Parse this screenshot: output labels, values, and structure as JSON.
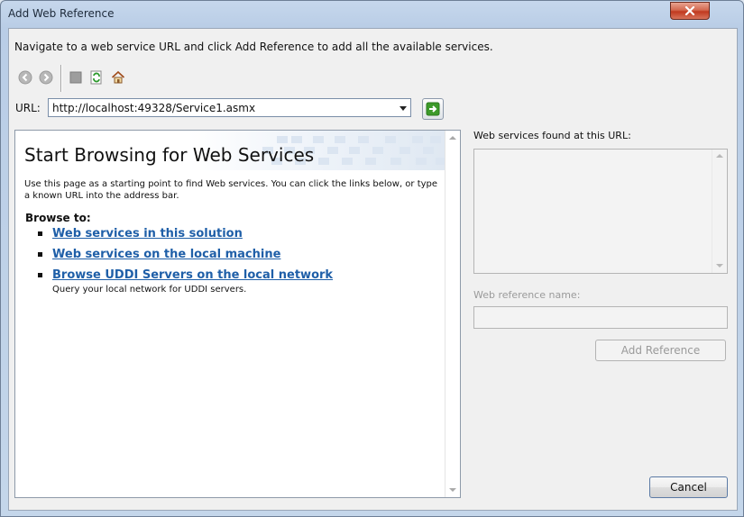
{
  "window": {
    "title": "Add Web Reference"
  },
  "instructions": "Navigate to a web service URL and click Add Reference to add all the available services.",
  "toolbar": {
    "icons": [
      "back-icon",
      "forward-icon",
      "stop-icon",
      "refresh-icon",
      "home-icon"
    ]
  },
  "url": {
    "label": "URL:",
    "value": "http://localhost:49328/Service1.asmx"
  },
  "browser": {
    "heading": "Start Browsing for Web Services",
    "intro": "Use this page as a starting point to find Web services. You can click the links below, or type a known URL into the address bar.",
    "browse_to": "Browse to:",
    "links": [
      {
        "label": "Web services in this solution"
      },
      {
        "label": "Web services on the local machine"
      },
      {
        "label": "Browse UDDI Servers on the local network",
        "description": "Query your local network for UDDI servers."
      }
    ]
  },
  "services": {
    "found_label": "Web services found at this URL:",
    "ref_name_label": "Web reference name:",
    "ref_name_value": ""
  },
  "buttons": {
    "add_reference": "Add Reference",
    "cancel": "Cancel"
  },
  "colors": {
    "link": "#1f5fa8",
    "go_arrow": "#3c9a2a"
  }
}
